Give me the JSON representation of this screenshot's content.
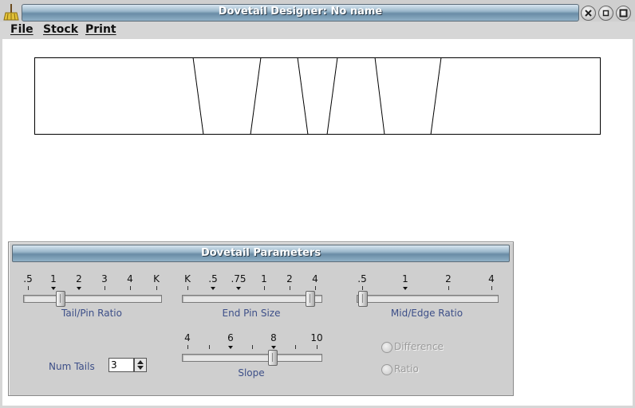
{
  "window": {
    "title": "Dovetail Designer: No name"
  },
  "menu": {
    "file": "File",
    "stock": "Stock",
    "print": "Print"
  },
  "panel": {
    "title": "Dovetail Parameters",
    "tail_pin_ratio": {
      "caption": "Tail/Pin Ratio",
      "ticks": [
        ".5",
        "1",
        "2",
        "3",
        "4",
        "K"
      ],
      "value": "1"
    },
    "end_pin_size": {
      "caption": "End Pin Size",
      "ticks": [
        "K",
        ".5",
        ".75",
        "1",
        "2",
        "4"
      ],
      "value": "4"
    },
    "mid_edge_ratio": {
      "caption": "Mid/Edge Ratio",
      "ticks": [
        ".5",
        "1",
        "2",
        "4"
      ],
      "value": ".5"
    },
    "slope": {
      "caption": "Slope",
      "ticks": [
        "4",
        "6",
        "8",
        "10"
      ],
      "value": 8
    },
    "num_tails": {
      "label": "Num Tails",
      "value": "3"
    },
    "mode": {
      "options": [
        "Difference",
        "Ratio"
      ]
    }
  },
  "colors": {
    "title_gradient": "#6a8ca6",
    "caption_text": "#3d4f88",
    "panel_bg": "#cfcfcf"
  },
  "icons": {
    "app": "broom-icon",
    "close": "close-icon",
    "minimize": "minimize-icon",
    "maximize": "maximize-icon",
    "spin": "spin-arrows-icon"
  }
}
